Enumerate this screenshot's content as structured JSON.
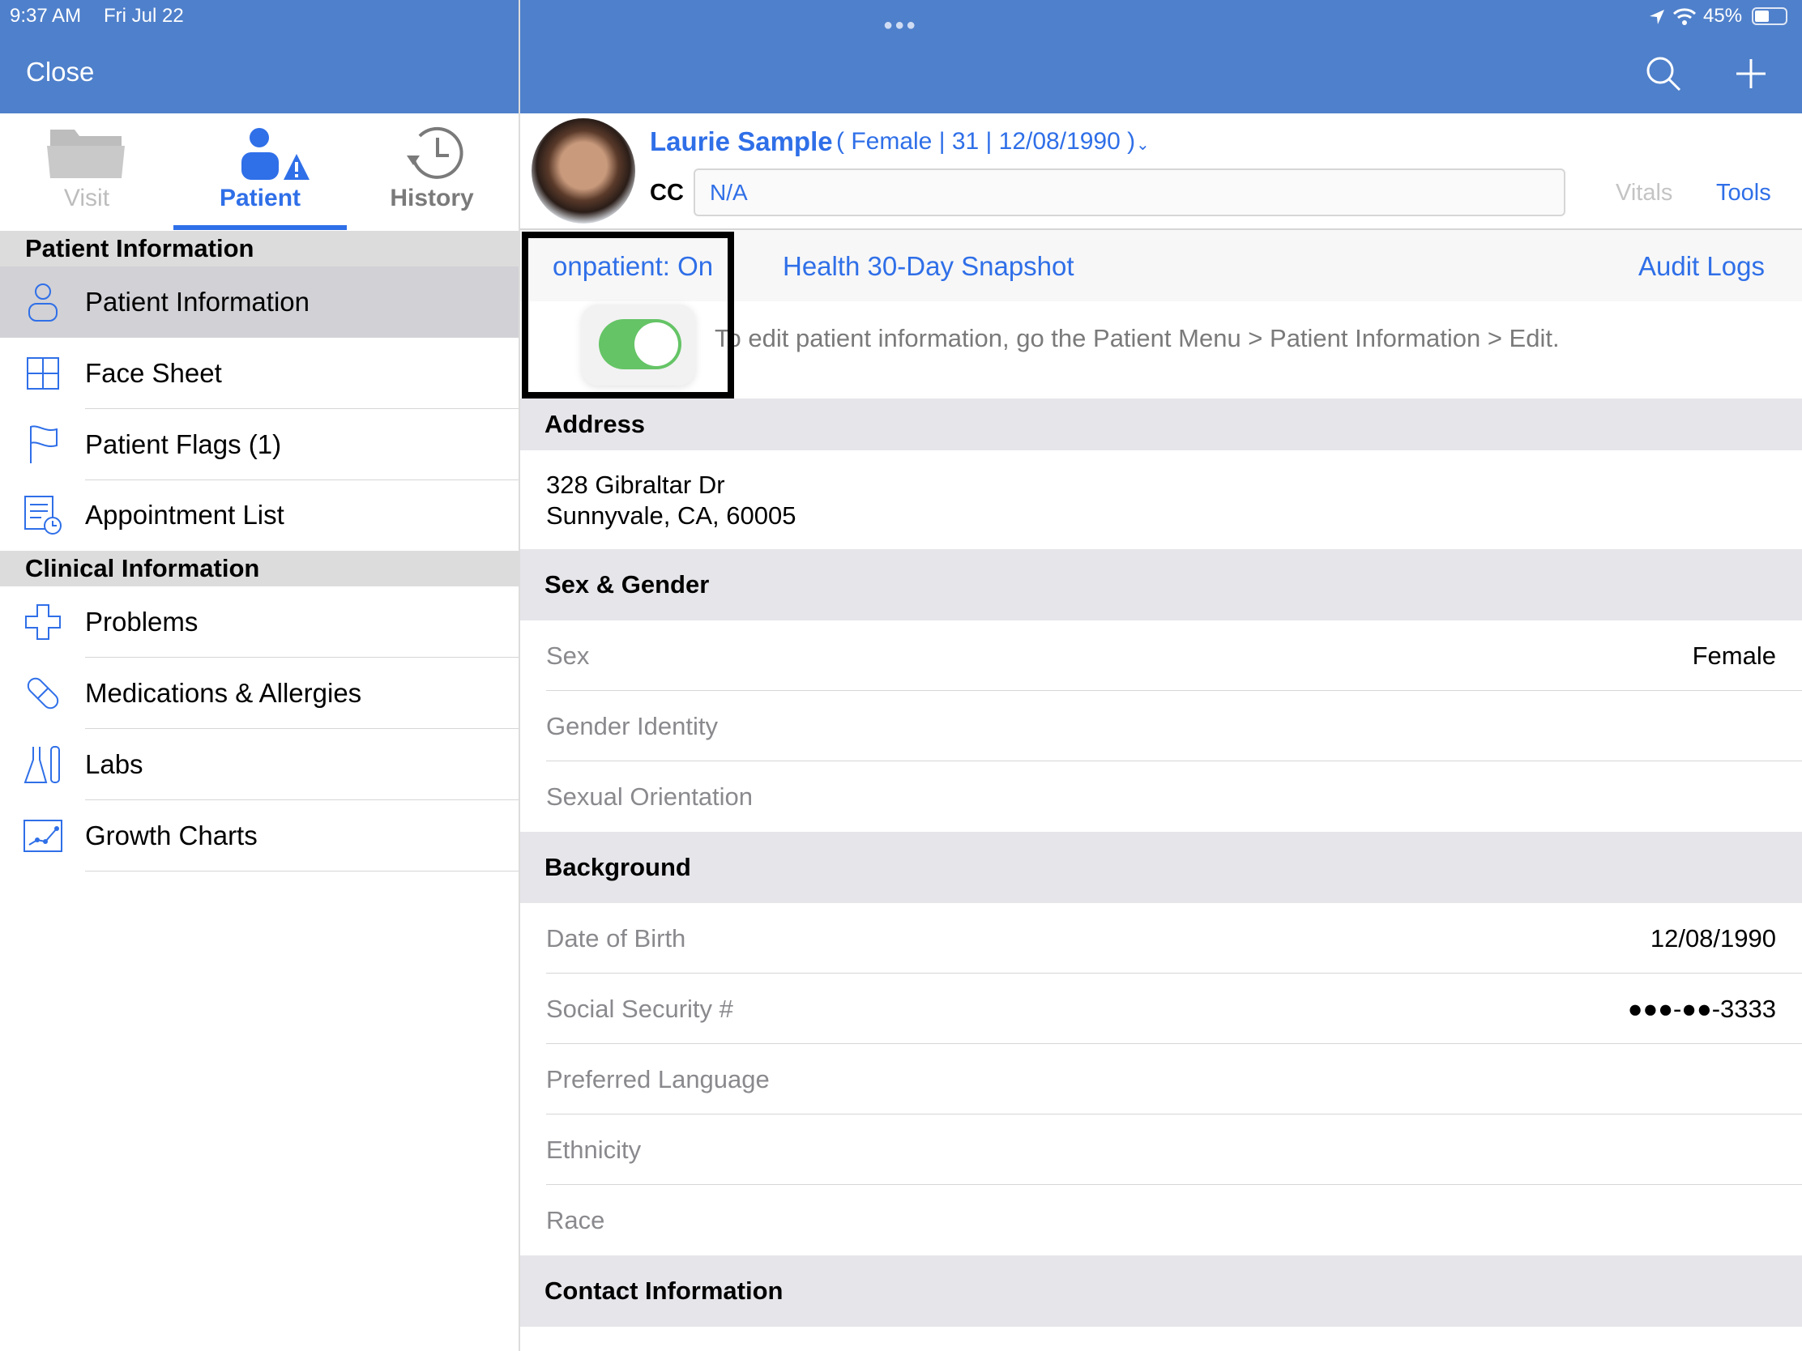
{
  "status_bar": {
    "time": "9:37 AM",
    "date": "Fri Jul 22",
    "battery": "45%"
  },
  "header": {
    "close_label": "Close"
  },
  "tabs": [
    {
      "label": "Visit",
      "icon": "folder-icon"
    },
    {
      "label": "Patient",
      "icon": "patient-alert-icon",
      "active": true
    },
    {
      "label": "History",
      "icon": "history-icon"
    }
  ],
  "sidebar": {
    "sections": [
      {
        "title": "Patient Information",
        "items": [
          {
            "label": "Patient Information",
            "selected": true
          },
          {
            "label": "Face Sheet"
          },
          {
            "label": "Patient Flags (1)"
          },
          {
            "label": "Appointment List"
          }
        ]
      },
      {
        "title": "Clinical Information",
        "items": [
          {
            "label": "Problems"
          },
          {
            "label": "Medications & Allergies"
          },
          {
            "label": "Labs"
          },
          {
            "label": "Growth Charts"
          }
        ]
      }
    ]
  },
  "patient": {
    "name": "Laurie Sample",
    "summary": "( Female | 31 | 12/08/1990 )",
    "cc_label": "CC",
    "cc_value": "N/A"
  },
  "actions": {
    "vitals": "Vitals",
    "tools": "Tools"
  },
  "links": {
    "onpatient": "onpatient: On",
    "snapshot": "Health 30-Day Snapshot",
    "audit": "Audit Logs"
  },
  "toggle": {
    "on": true
  },
  "notice": "To edit patient information, go the Patient Menu > Patient Information > Edit.",
  "address": {
    "title": "Address",
    "line1": "328 Gibraltar Dr",
    "line2": "Sunnyvale, CA, 60005"
  },
  "sex_gender": {
    "title": "Sex & Gender",
    "rows": [
      {
        "k": "Sex",
        "v": "Female"
      },
      {
        "k": "Gender Identity",
        "v": ""
      },
      {
        "k": "Sexual Orientation",
        "v": ""
      }
    ]
  },
  "background": {
    "title": "Background",
    "rows": [
      {
        "k": "Date of Birth",
        "v": "12/08/1990"
      },
      {
        "k": "Social Security #",
        "v": "●●●-●●-3333"
      },
      {
        "k": "Preferred Language",
        "v": ""
      },
      {
        "k": "Ethnicity",
        "v": ""
      },
      {
        "k": "Race",
        "v": ""
      }
    ]
  },
  "contact": {
    "title": "Contact Information"
  },
  "colors": {
    "header": "#4f80cb",
    "accent": "#2f6fe8",
    "toggle_on": "#65c466"
  }
}
